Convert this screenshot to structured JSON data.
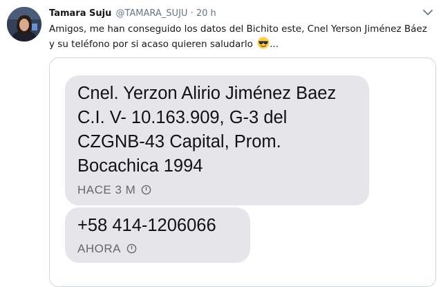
{
  "tweet": {
    "author_name": "Tamara Suju",
    "handle": "@TAMARA_SUJU",
    "separator": "·",
    "time": "20 h",
    "text_line_1": "Amigos, me han conseguido los datos del Bichito este, Cnel Yerson Jiménez Báez",
    "text_line_2": "y su teléfono por si acaso quieren saludarlo",
    "ellipsis": "...",
    "emoji": "smiling-face-with-sunglasses"
  },
  "media": {
    "messages": [
      {
        "text": "Cnel. Yerzon Alirio Jiménez Baez\nC.I. V- 10.163.909, G-3 del\nCZGNB-43 Capital, Prom.\nBocachica 1994",
        "timestamp": "HACE 3 M"
      },
      {
        "text": "+58 414-1206066",
        "timestamp": "AHORA"
      }
    ],
    "bubble_color": "#e6e6ea"
  },
  "icons": {
    "avatar": "profile-photo",
    "caret": "chevron-down-icon",
    "timestamp_icon": "clock-icon"
  }
}
